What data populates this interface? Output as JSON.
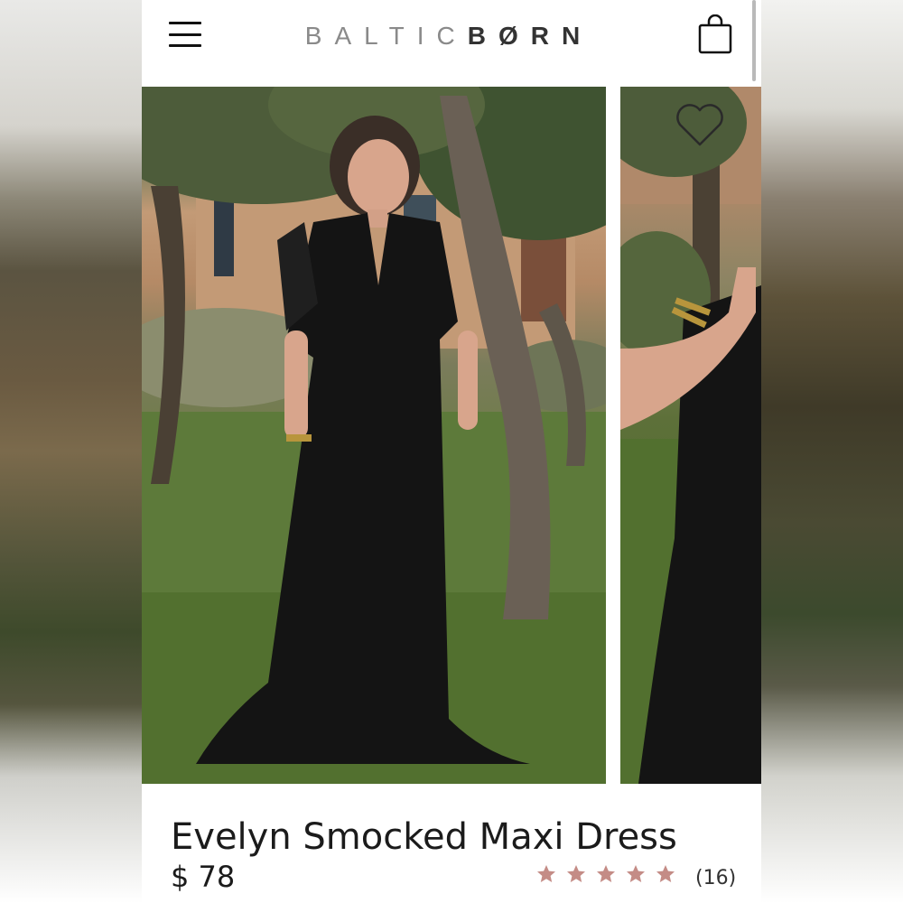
{
  "header": {
    "logo_light": "BALTIC",
    "logo_dark": "BØRN",
    "menu_icon": "hamburger-menu-icon",
    "cart_icon": "shopping-bag-icon"
  },
  "gallery": {
    "images": [
      {
        "alt": "model-wearing-black-maxi-dress-full-length"
      },
      {
        "alt": "model-wearing-black-maxi-dress-side-detail"
      }
    ],
    "favorite_icon": "heart-icon"
  },
  "product": {
    "title": "Evelyn Smocked Maxi Dress",
    "price": "$ 78",
    "rating_stars": 5,
    "review_count": "(16)"
  },
  "colors": {
    "star": "#c48c86",
    "text": "#1b1b1b",
    "logo_light": "#8a8a8a",
    "logo_dark": "#333333"
  }
}
